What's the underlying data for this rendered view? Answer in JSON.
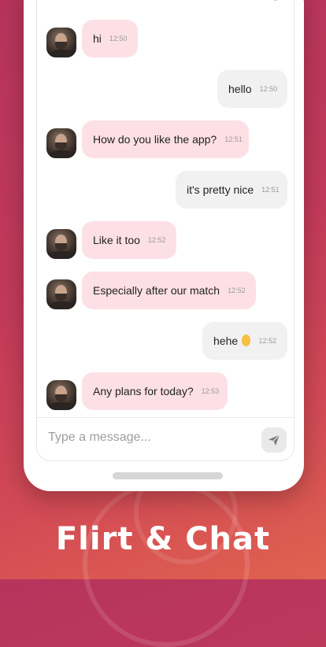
{
  "chat": {
    "messages": [
      {
        "dir": "in",
        "text": "hi",
        "time": "12:50"
      },
      {
        "dir": "out",
        "text": "hello",
        "time": "12:50"
      },
      {
        "dir": "in",
        "text": "How do you like the app?",
        "time": "12:51"
      },
      {
        "dir": "out",
        "text": "it's pretty nice",
        "time": "12:51"
      },
      {
        "dir": "in",
        "text": "Like it too",
        "time": "12:52"
      },
      {
        "dir": "in",
        "text": "Especially after our match",
        "time": "12:52"
      },
      {
        "dir": "out",
        "text": "hehe",
        "time": "12:52"
      },
      {
        "dir": "in",
        "text": "Any plans for today?",
        "time": "12:53"
      }
    ]
  },
  "composer": {
    "placeholder": "Type a message..."
  },
  "icons": {
    "send": "send-icon",
    "emoji": "smiling-face-emoji"
  },
  "colors": {
    "incoming_bubble": "#fde0e6",
    "outgoing_bubble": "#f1f1f1",
    "background_top": "#b6345c",
    "background_bottom": "#e0624f"
  },
  "marketing": {
    "tagline": "Flirt & Chat"
  }
}
